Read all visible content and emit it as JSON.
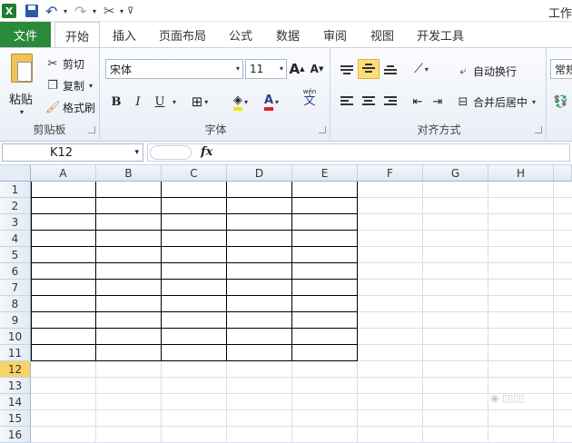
{
  "titlebar": {
    "app_icon": "excel-logo",
    "window_title": "工作",
    "icons": [
      "save-icon",
      "undo-icon",
      "redo-icon",
      "tools-icon",
      "qat-customize-icon"
    ]
  },
  "tabs": {
    "file": "文件",
    "items": [
      "开始",
      "插入",
      "页面布局",
      "公式",
      "数据",
      "审阅",
      "视图",
      "开发工具"
    ],
    "active": "开始"
  },
  "clipboard": {
    "paste": "粘贴",
    "cut": "剪切",
    "copy": "复制",
    "format_painter": "格式刷",
    "label": "剪贴板"
  },
  "font": {
    "name": "宋体",
    "size": "11",
    "bold": "B",
    "italic": "I",
    "underline": "U",
    "grow": "A",
    "shrink": "A",
    "font_color_glyph": "A",
    "phonetic": "wén",
    "phonetic_char": "文",
    "label": "字体"
  },
  "alignment": {
    "wrap_text": "自动换行",
    "merge_center": "合并后居中",
    "label": "对齐方式"
  },
  "number": {
    "format": "常规"
  },
  "formula_bar": {
    "name_box": "K12",
    "fx": "fx",
    "formula": ""
  },
  "sheet": {
    "columns": [
      "A",
      "B",
      "C",
      "D",
      "E",
      "F",
      "G",
      "H"
    ],
    "rows": [
      "1",
      "2",
      "3",
      "4",
      "5",
      "6",
      "7",
      "8",
      "9",
      "10",
      "11",
      "12",
      "13",
      "14",
      "15",
      "16"
    ],
    "selected_row": "12",
    "bordered_range": "A1:E11"
  },
  "colors": {
    "file_tab": "#2a8a3a",
    "selected_header": "#f8d36a",
    "font_color": "#e02020",
    "highlight": "#f5e400"
  }
}
